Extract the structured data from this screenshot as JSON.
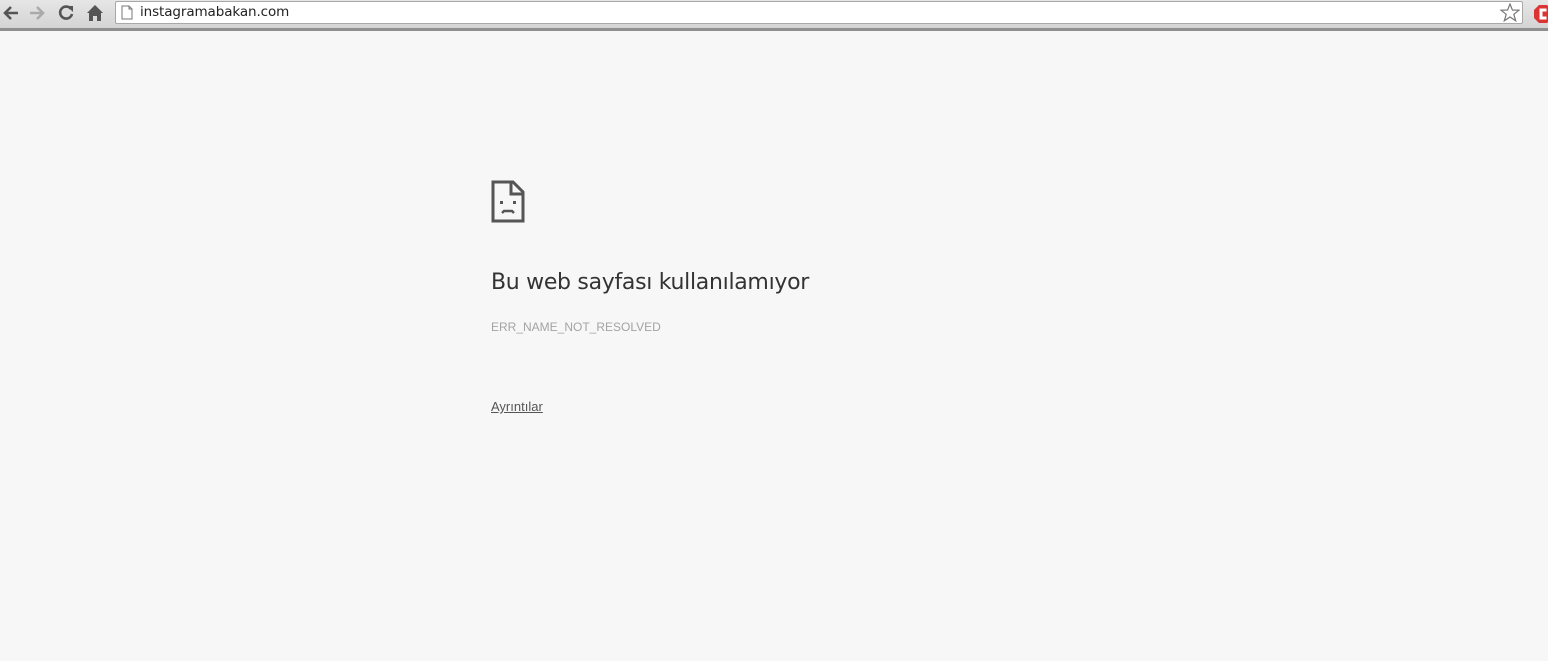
{
  "browser": {
    "address_bar": {
      "url": "instagramabakan.com"
    },
    "nav_icons": [
      "back-arrow-icon",
      "forward-arrow-icon",
      "reload-icon",
      "home-icon"
    ],
    "bookmark_icon": "star-icon",
    "extension_icon": "adblock-icon",
    "colors": {
      "toolbar": "#dcdcdc",
      "page_background": "#f7f7f7"
    }
  },
  "error_page": {
    "icon": "sad-page-icon",
    "title": "Bu web sayfası kullanılamıyor",
    "error_code": "ERR_NAME_NOT_RESOLVED",
    "details_link": "Ayrıntılar"
  }
}
